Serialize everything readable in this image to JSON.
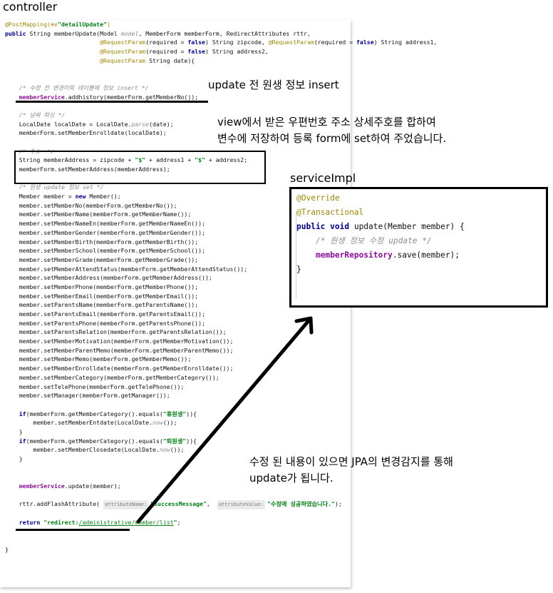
{
  "titles": {
    "controller": "controller",
    "service_impl": "serviceImpl"
  },
  "controller_code": [
    [
      {
        "c": "ann",
        "t": "@PostMapping("
      },
      {
        "c": "ann",
        "t": "⊕∨"
      },
      {
        "c": "str",
        "t": "\"detailUpdate\""
      },
      {
        "c": "ann",
        "t": ")"
      }
    ],
    [
      {
        "c": "kw",
        "t": "public "
      },
      {
        "c": "",
        "t": "String memberUpdate(Model "
      },
      {
        "c": "cm",
        "t": "model"
      },
      {
        "c": "",
        "t": ", MemberForm memberForm, RedirectAttributes rttr,"
      }
    ],
    [
      {
        "c": "",
        "t": "                           "
      },
      {
        "c": "ann",
        "t": "@RequestParam"
      },
      {
        "c": "",
        "t": "(required = "
      },
      {
        "c": "kw",
        "t": "false"
      },
      {
        "c": "",
        "t": ") String zipcode, "
      },
      {
        "c": "ann",
        "t": "@RequestParam"
      },
      {
        "c": "",
        "t": "(required = "
      },
      {
        "c": "kw",
        "t": "false"
      },
      {
        "c": "",
        "t": ") String address1,"
      }
    ],
    [
      {
        "c": "",
        "t": "                           "
      },
      {
        "c": "ann",
        "t": "@RequestParam"
      },
      {
        "c": "",
        "t": "(required = "
      },
      {
        "c": "kw",
        "t": "false"
      },
      {
        "c": "",
        "t": ") String address2,"
      }
    ],
    [
      {
        "c": "",
        "t": "                           "
      },
      {
        "c": "ann",
        "t": "@RequestParam"
      },
      {
        "c": "",
        "t": " String date){"
      }
    ],
    [],
    [],
    [
      {
        "c": "",
        "t": "    "
      },
      {
        "c": "cm",
        "t": "/* 수정 전 변경이력 테이블에 정보 insert */"
      }
    ],
    [
      {
        "c": "",
        "t": "    "
      },
      {
        "c": "fld",
        "t": "memberService"
      },
      {
        "c": "",
        "t": ".addhistory(memberForm.getMemberNo());"
      }
    ],
    [],
    [
      {
        "c": "",
        "t": "    "
      },
      {
        "c": "cm",
        "t": "/* 날짜 파싱 */"
      }
    ],
    [
      {
        "c": "",
        "t": "    LocalDate localDate = LocalDate."
      },
      {
        "c": "cm",
        "t": "parse"
      },
      {
        "c": "",
        "t": "(date);"
      }
    ],
    [
      {
        "c": "",
        "t": "    memberForm.setMemberEnrolldate(localDate);"
      }
    ],
    [],
    [
      {
        "c": "",
        "t": "    "
      },
      {
        "c": "cm",
        "t": "/* 주소  */"
      }
    ],
    [
      {
        "c": "",
        "t": "    String memberAddress = zipcode + "
      },
      {
        "c": "str",
        "t": "\"$\""
      },
      {
        "c": "",
        "t": " + address1 + "
      },
      {
        "c": "str",
        "t": "\"$\""
      },
      {
        "c": "",
        "t": " + address2;"
      }
    ],
    [
      {
        "c": "",
        "t": "    memberForm.setMemberAddress(memberAddress);"
      }
    ],
    [],
    [
      {
        "c": "",
        "t": "    "
      },
      {
        "c": "cm",
        "t": "/* 원생 update 정보 set */"
      }
    ],
    [
      {
        "c": "",
        "t": "    Member member = "
      },
      {
        "c": "kw",
        "t": "new "
      },
      {
        "c": "",
        "t": "Member();"
      }
    ],
    [
      {
        "c": "",
        "t": "    member.setMemberNo(memberForm.getMemberNo());"
      }
    ],
    [
      {
        "c": "",
        "t": "    member.setMemberName(memberForm.getMemberName());"
      }
    ],
    [
      {
        "c": "",
        "t": "    member.setMemberNameEn(memberForm.getMemberNameEn());"
      }
    ],
    [
      {
        "c": "",
        "t": "    member.setMemberGender(memberForm.getMemberGender());"
      }
    ],
    [
      {
        "c": "",
        "t": "    member.setMemberBirth(memberForm.getMemberBirth());"
      }
    ],
    [
      {
        "c": "",
        "t": "    member.setMemberSchool(memberForm.getMemberSchool());"
      }
    ],
    [
      {
        "c": "",
        "t": "    member.setMemberGrade(memberForm.getMemberGrade());"
      }
    ],
    [
      {
        "c": "",
        "t": "    member.setMemberAttendStatus(memberForm.getMemberAttendStatus());"
      }
    ],
    [
      {
        "c": "",
        "t": "    member.setMemberAddress(memberForm.getMemberAddress());"
      }
    ],
    [
      {
        "c": "",
        "t": "    member.setMemberPhone(memberForm.getMemberPhone());"
      }
    ],
    [
      {
        "c": "",
        "t": "    member.setMemberEmail(memberForm.getMemberEmail());"
      }
    ],
    [
      {
        "c": "",
        "t": "    member.setParentsName(memberForm.getParentsName());"
      }
    ],
    [
      {
        "c": "",
        "t": "    member.setParentsEmail(memberForm.getParentsEmail());"
      }
    ],
    [
      {
        "c": "",
        "t": "    member.setParentsPhone(memberForm.getParentsPhone());"
      }
    ],
    [
      {
        "c": "",
        "t": "    member.setParentsRelation(memberForm.getParentsRelation());"
      }
    ],
    [
      {
        "c": "",
        "t": "    member.setMemberMotivation(memberForm.getMemberMotivation());"
      }
    ],
    [
      {
        "c": "",
        "t": "    member.setMemberParentMemo(memberForm.getMemberParentMemo());"
      }
    ],
    [
      {
        "c": "",
        "t": "    member.setMemberMemo(memberForm.getMemberMemo());"
      }
    ],
    [
      {
        "c": "",
        "t": "    member.setMemberEnrolldate(memberForm.getMemberEnrolldate());"
      }
    ],
    [
      {
        "c": "",
        "t": "    member.setMemberCategory(memberForm.getMemberCategory());"
      }
    ],
    [
      {
        "c": "",
        "t": "    member.setTelePhone(memberForm.getTelePhone());"
      }
    ],
    [
      {
        "c": "",
        "t": "    member.setManager(memberForm.getManager());"
      }
    ],
    [],
    [
      {
        "c": "",
        "t": "    "
      },
      {
        "c": "kw",
        "t": "if"
      },
      {
        "c": "",
        "t": "(memberForm.getMemberCategory().equals("
      },
      {
        "c": "str",
        "t": "\"휴원생\""
      },
      {
        "c": "",
        "t": ")){"
      }
    ],
    [
      {
        "c": "",
        "t": "        member.setMemberEntdate(LocalDate."
      },
      {
        "c": "cm",
        "t": "now"
      },
      {
        "c": "",
        "t": "());"
      }
    ],
    [
      {
        "c": "",
        "t": "    }"
      }
    ],
    [
      {
        "c": "",
        "t": "    "
      },
      {
        "c": "kw",
        "t": "if"
      },
      {
        "c": "",
        "t": "(memberForm.getMemberCategory().equals("
      },
      {
        "c": "str",
        "t": "\"퇴원생\""
      },
      {
        "c": "",
        "t": ")){"
      }
    ],
    [
      {
        "c": "",
        "t": "        member.setMemberClosedate(LocalDate."
      },
      {
        "c": "cm",
        "t": "now"
      },
      {
        "c": "",
        "t": "());"
      }
    ],
    [
      {
        "c": "",
        "t": "    }"
      }
    ],
    [],
    [],
    [
      {
        "c": "",
        "t": "    "
      },
      {
        "c": "fld",
        "t": "memberService"
      },
      {
        "c": "",
        "t": ".update(member);"
      }
    ],
    [],
    [
      {
        "c": "",
        "t": "    rttr.addFlashAttribute( "
      },
      {
        "c": "hint",
        "t": "attributeName:"
      },
      {
        "c": "str",
        "t": "\"successMessage\""
      },
      {
        "c": "",
        "t": ",  "
      },
      {
        "c": "hint",
        "t": "attributeValue:"
      },
      {
        "c": "str",
        "t": "\"수정에 성공하였습니다.\""
      },
      {
        "c": "",
        "t": ");"
      }
    ],
    [],
    [
      {
        "c": "",
        "t": "    "
      },
      {
        "c": "kw",
        "t": "return "
      },
      {
        "c": "str",
        "t": "\"redirect:"
      },
      {
        "c": "link",
        "t": "/administrative/member/list"
      },
      {
        "c": "str",
        "t": "\""
      },
      {
        "c": "",
        "t": ";"
      }
    ],
    [],
    [],
    [
      {
        "c": "",
        "t": "}"
      }
    ]
  ],
  "service_code": [
    [
      {
        "c": "ann",
        "t": "@Override"
      }
    ],
    [
      {
        "c": "ann",
        "t": "@Transactional"
      }
    ],
    [
      {
        "c": "kw",
        "t": "public void "
      },
      {
        "c": "",
        "t": "update(Member member) {"
      }
    ],
    [],
    [
      {
        "c": "",
        "t": "    "
      },
      {
        "c": "cm",
        "t": "/* 원생 정보 수정 update */"
      }
    ],
    [
      {
        "c": "",
        "t": "    "
      },
      {
        "c": "fld",
        "t": "memberRepository"
      },
      {
        "c": "",
        "t": ".save(member);"
      }
    ],
    [],
    [
      {
        "c": "",
        "t": "}"
      }
    ]
  ],
  "notes": {
    "insert_note": "update 전 원생 정보 insert",
    "address_note_1": "view에서 받은 우편번호 주소 상세주호를 합하여",
    "address_note_2": "변수에 저장하여 등록 form에 set하여 주었습니다.",
    "jpa_note_1": "수정 된 내용이 있으면 JPA의 변경감지를 통해",
    "jpa_note_2": "update가 됩니다."
  },
  "colors": {
    "annotation": "#9e880d",
    "keyword": "#000080",
    "string": "#067d17",
    "comment": "#8c8c8c",
    "field": "#871094",
    "highlight_box": "#000000"
  }
}
